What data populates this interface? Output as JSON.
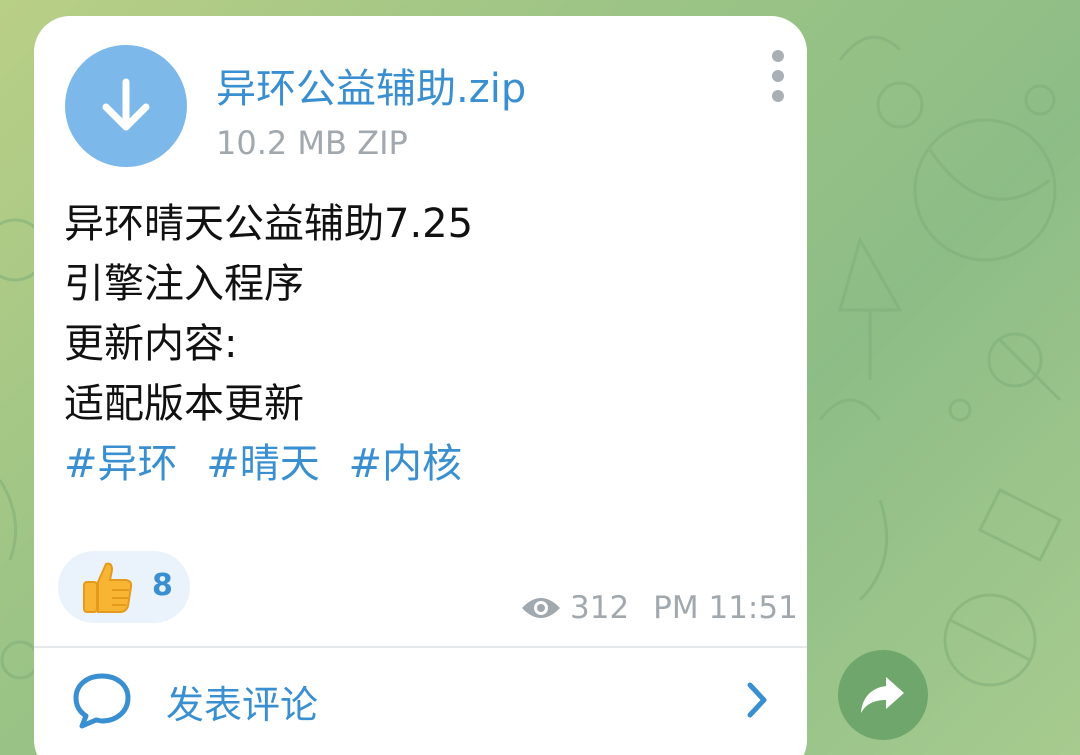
{
  "file": {
    "name": "异环公益辅助.zip",
    "meta": "10.2 MB ZIP",
    "icon": "download-icon",
    "icon_color": "#7cb8ea"
  },
  "message": {
    "lines": [
      "异环晴天公益辅助7.25",
      "引擎注入程序",
      "更新内容:",
      "适配版本更新"
    ],
    "hashtags": [
      "#异环",
      "#晴天",
      "#内核"
    ]
  },
  "reaction": {
    "emoji": "thumbs-up-icon",
    "count": "8"
  },
  "footer": {
    "views": "312",
    "time": "PM 11:51"
  },
  "comment": {
    "label": "发表评论",
    "icon": "comment-bubble-icon"
  },
  "colors": {
    "link": "#3a8fd0",
    "muted": "#a1a8ae",
    "share_button": "#6fa66b"
  }
}
